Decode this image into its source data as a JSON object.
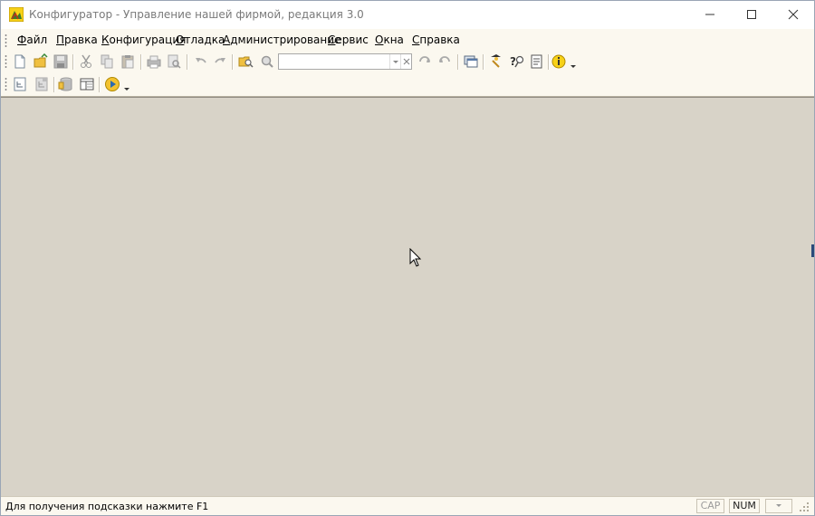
{
  "window": {
    "title": "Конфигуратор - Управление нашей фирмой, редакция 3.0",
    "app_icon": "1c-logo-icon"
  },
  "menu": [
    {
      "label": "Файл"
    },
    {
      "label": "Правка"
    },
    {
      "label": "Конфигурация"
    },
    {
      "label": "Отладка"
    },
    {
      "label": "Администрирование"
    },
    {
      "label": "Сервис"
    },
    {
      "label": "Окна"
    },
    {
      "label": "Справка"
    }
  ],
  "toolbar": {
    "search_value": "",
    "buttons_row1": [
      "new-document-icon",
      "open-folder-icon",
      "save-icon",
      "cut-icon",
      "copy-icon",
      "paste-icon",
      "print-icon",
      "print-preview-icon",
      "undo-icon",
      "redo-icon",
      "find-in-tree-icon",
      "search-icon",
      "search-next-icon",
      "search-prev-icon",
      "windows-icon",
      "wizard-icon",
      "help-search-icon",
      "help-contents-icon",
      "info-icon"
    ],
    "buttons_row2": [
      "open-config-icon",
      "open-db-config-icon",
      "database-icon",
      "module-icon",
      "start-debugging-icon"
    ]
  },
  "status": {
    "hint": "Для получения подсказки нажмите F1",
    "cap": "CAP",
    "num": "NUM"
  },
  "colors": {
    "workspace": "#d8d3c8",
    "chrome": "#fbf8ef",
    "accent_blue": "#2b4a7a"
  }
}
